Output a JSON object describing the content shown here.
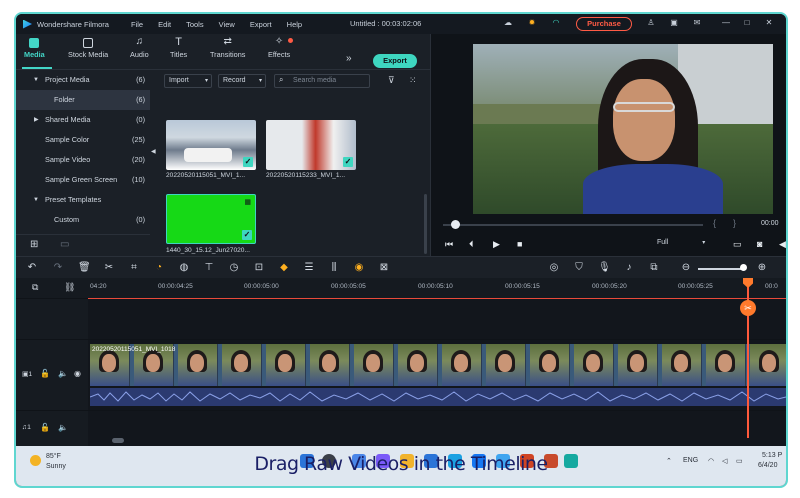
{
  "app": {
    "name": "Wondershare Filmora",
    "menu": [
      "File",
      "Edit",
      "Tools",
      "View",
      "Export",
      "Help"
    ],
    "project_title": "Untitled : 00:03:02:06",
    "purchase_label": "Purchase"
  },
  "tabs": [
    {
      "label": "Media",
      "icon": "media-icon",
      "active": true
    },
    {
      "label": "Stock Media",
      "icon": "stock-media-icon",
      "active": false
    },
    {
      "label": "Audio",
      "icon": "music-note-icon",
      "active": false
    },
    {
      "label": "Titles",
      "icon": "text-t-icon",
      "active": false
    },
    {
      "label": "Transitions",
      "icon": "transitions-icon",
      "active": false
    },
    {
      "label": "Effects",
      "icon": "effects-icon",
      "active": false
    }
  ],
  "export_label": "Export",
  "media_tree": [
    {
      "label": "Project Media",
      "count": "(6)",
      "expanded": true
    },
    {
      "label": "Folder",
      "count": "(6)",
      "selected": true
    },
    {
      "label": "Shared Media",
      "count": "(0)",
      "expanded": false
    },
    {
      "label": "Sample Color",
      "count": "(25)"
    },
    {
      "label": "Sample Video",
      "count": "(20)"
    },
    {
      "label": "Sample Green Screen",
      "count": "(10)"
    },
    {
      "label": "Preset Templates",
      "count": "",
      "expanded": true
    },
    {
      "label": "Custom",
      "count": "(0)"
    }
  ],
  "media_toolbar": {
    "import_label": "Import",
    "record_label": "Record",
    "search_placeholder": "Search media"
  },
  "media_items": [
    {
      "label": "20220520115051_MVI_1...",
      "checked": true
    },
    {
      "label": "20220520115233_MVI_1...",
      "checked": true
    },
    {
      "label": "1440_30_15.12_Jun27020...",
      "checked": true
    }
  ],
  "preview": {
    "progress": 0.03,
    "quality_label": "Full",
    "time": "00:00"
  },
  "ruler_labels": [
    "04:20",
    "00:00:04:25",
    "00:00:05:00",
    "00:00:05:05",
    "00:00:05:10",
    "00:00:05:15",
    "00:00:05:20",
    "00:00:05:25",
    "00:0"
  ],
  "clip_title": "20220520115051_MVI_1018",
  "tracks": {
    "video_label": "▣1",
    "audio_label": "♫1"
  },
  "taskbar": {
    "temperature": "85°F",
    "weather": "Sunny",
    "caption": "Drag Raw Videos in the Timeline",
    "language": "ENG",
    "time": "5:13 P",
    "date": "6/4/20"
  }
}
